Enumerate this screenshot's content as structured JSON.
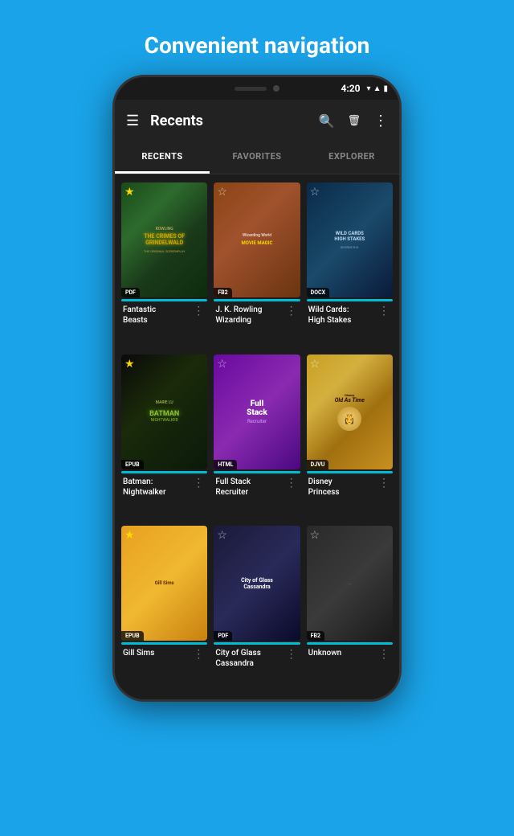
{
  "page": {
    "title": "Convenient navigation",
    "background_color": "#1aa3e8"
  },
  "status_bar": {
    "time": "4:20",
    "wifi_icon": "▼",
    "signal_icon": "▲",
    "battery_icon": "▮"
  },
  "top_bar": {
    "menu_icon": "☰",
    "title": "Recents",
    "search_icon": "🔍",
    "delete_icon": "🗑",
    "more_icon": "⋮"
  },
  "tabs": [
    {
      "label": "RECENTS",
      "active": true
    },
    {
      "label": "FAVORITES",
      "active": false
    },
    {
      "label": "EXPLORER",
      "active": false
    }
  ],
  "books": [
    {
      "id": "fantastic-beasts",
      "title": "Fantastic Beasts",
      "format": "PDF",
      "starred": true,
      "cover_type": "fantastic-beasts",
      "cover_text": "ROWLING\nTHE CRIMES OF\nGRINDELWALD",
      "sub_text": "ORIGINAL SCREENPLAY"
    },
    {
      "id": "jk-rowling-wizarding",
      "title": "J. K. Rowling Wizarding",
      "format": "FB2",
      "starred": false,
      "cover_type": "jk-rowling",
      "cover_text": "Wizarding World\nMOVIE MAGIC"
    },
    {
      "id": "wild-cards-high-stakes",
      "title": "Wild Cards: High Stakes",
      "format": "DOCX",
      "starred": false,
      "cover_type": "wild-cards",
      "cover_text": "Wild Cards\nHIGH STAKES"
    },
    {
      "id": "batman-nightwalker",
      "title": "Batman: Nightwalker",
      "format": "EPUB",
      "starred": true,
      "cover_type": "batman",
      "cover_text": "MARIE LU\nNIGHTWALKER"
    },
    {
      "id": "full-stack-recruiter",
      "title": "Full Stack Recruiter",
      "format": "HTML",
      "starred": false,
      "cover_type": "full-stack",
      "cover_text": "Full\nStack",
      "sub_text": "Recruiter"
    },
    {
      "id": "disney-princess",
      "title": "Disney Princess",
      "format": "DJVU",
      "starred": false,
      "cover_type": "disney",
      "cover_text": "Old As Time"
    },
    {
      "id": "gill-sims",
      "title": "Gill Sims",
      "format": "EPUB",
      "starred": true,
      "cover_type": "gill-sims",
      "cover_text": "Gill Sims"
    },
    {
      "id": "city-of-glass",
      "title": "City of Glass Cassandra",
      "format": "PDF",
      "starred": false,
      "cover_type": "city-glass",
      "cover_text": "City of Glass\nCassandra"
    },
    {
      "id": "unknown-book",
      "title": "Unknown",
      "format": "FB2",
      "starred": false,
      "cover_type": "unknown",
      "cover_text": ""
    }
  ]
}
